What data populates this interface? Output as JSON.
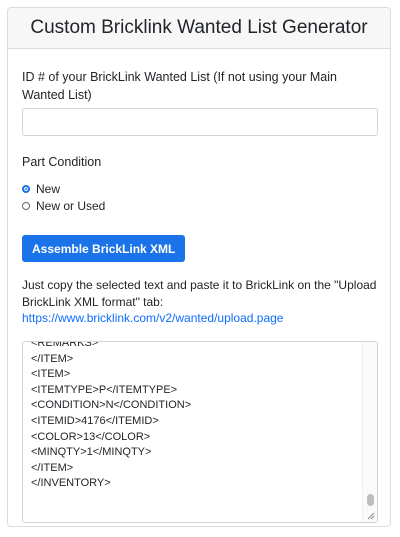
{
  "header": {
    "title": "Custom Bricklink Wanted List Generator"
  },
  "form": {
    "id_label": "ID # of your BrickLink Wanted List (If not using your Main Wanted List)",
    "id_value": "",
    "condition_label": "Part Condition",
    "conditions": [
      {
        "label": "New",
        "checked": true
      },
      {
        "label": "New or Used",
        "checked": false
      }
    ],
    "assemble_button": "Assemble BrickLink XML"
  },
  "instructions": {
    "text": "Just copy the selected text and paste it to BrickLink on the \"Upload BrickLink XML format\" tab:",
    "link": "https://www.bricklink.com/v2/wanted/upload.page"
  },
  "xml_output": {
    "lines": [
      "<REMARKS>",
      "</ITEM>",
      "<ITEM>",
      "<ITEMTYPE>P</ITEMTYPE>",
      "<CONDITION>N</CONDITION>",
      "<ITEMID>4176</ITEMID>",
      "<COLOR>13</COLOR>",
      "<MINQTY>1</MINQTY>",
      "</ITEM>",
      "</INVENTORY>"
    ]
  }
}
